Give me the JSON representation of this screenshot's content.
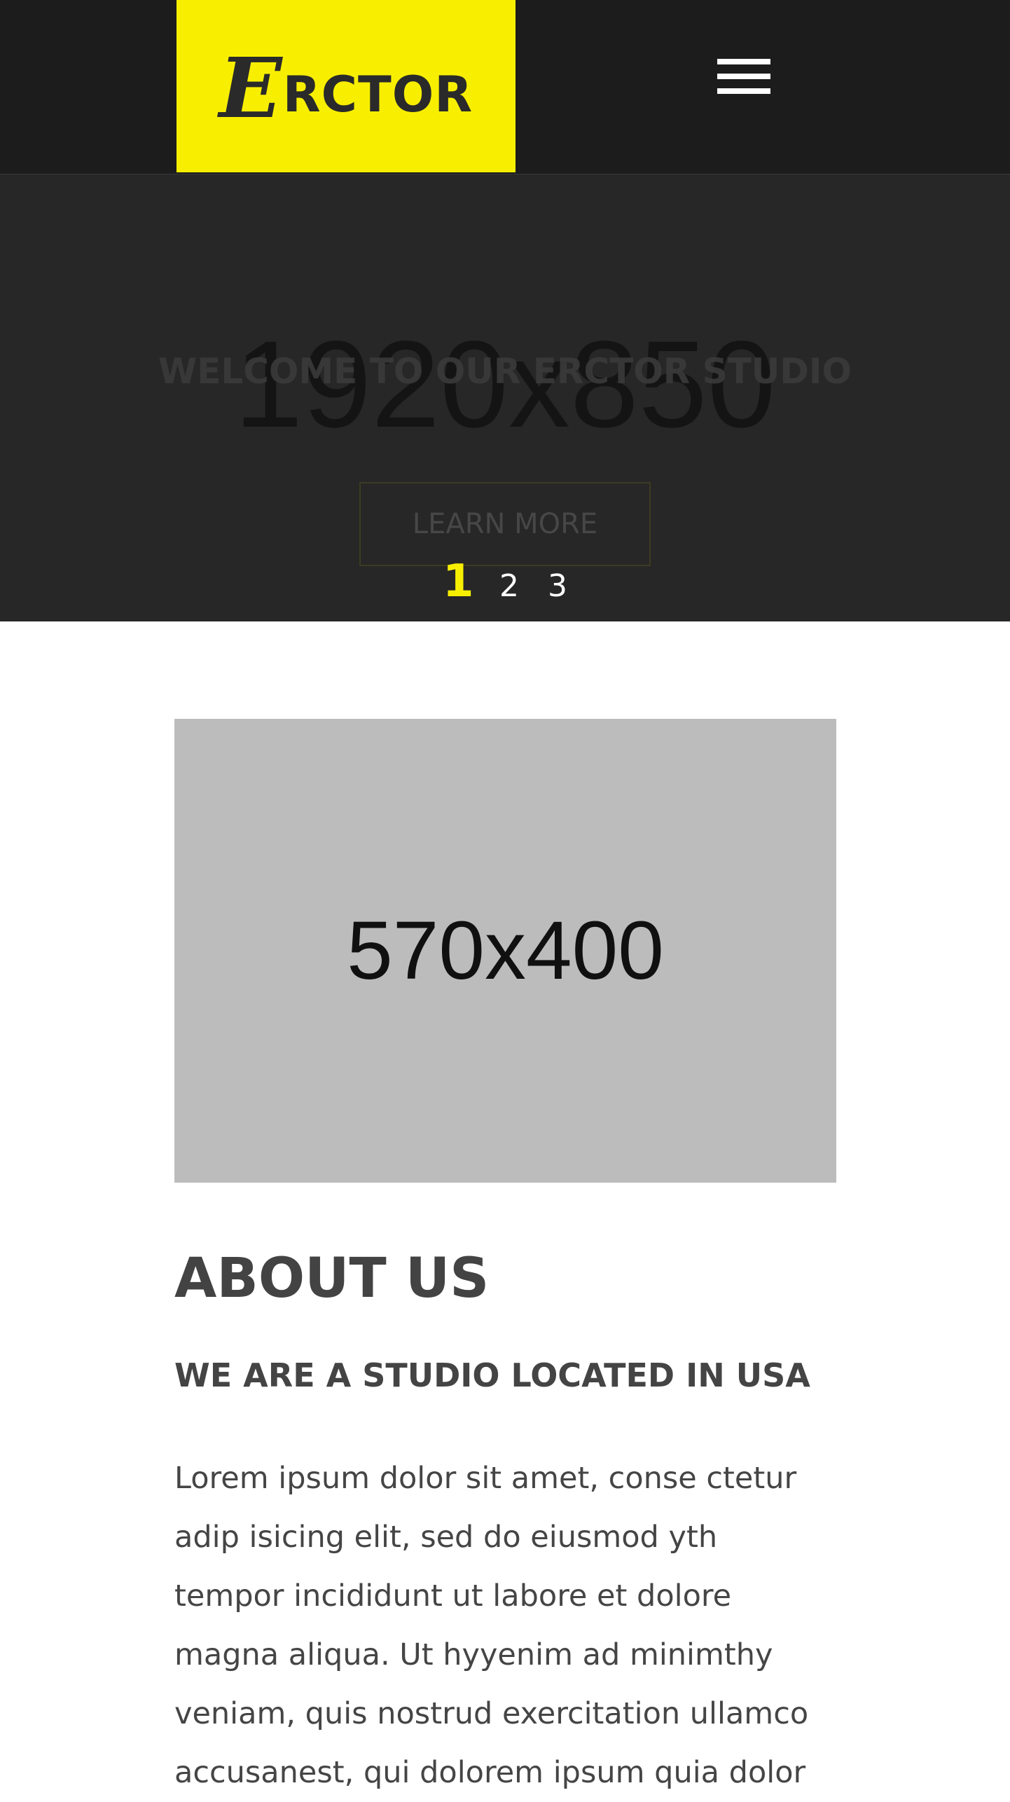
{
  "header": {
    "logo_initial": "E",
    "logo_rest": "RCTOR",
    "menu_icon": "hamburger-icon"
  },
  "hero": {
    "placeholder": "1920x850",
    "welcome": "WELCOME TO OUR ERCTOR STUDIO",
    "learn_more": "LEARN MORE",
    "pager": [
      "1",
      "2",
      "3"
    ],
    "active_page": "1"
  },
  "about": {
    "image_placeholder": "570x400",
    "title": "ABOUT US",
    "subtitle": "WE ARE A STUDIO LOCATED IN USA",
    "body_lines": [
      "Lorem ipsum dolor sit amet, conse ctetur",
      "adip isicing elit, sed do eiusmod yth",
      "tempor incididunt ut labore et dolore",
      "magna aliqua. Ut hyyenim ad minimthy",
      "veniam, quis nostrud exercitation ullamco",
      "accusanest, qui dolorem ipsum quia dolor"
    ]
  },
  "colors": {
    "accent": "#f8ef00",
    "header_bg": "#1c1c1c",
    "hero_bg": "#272727",
    "text": "#444444"
  }
}
